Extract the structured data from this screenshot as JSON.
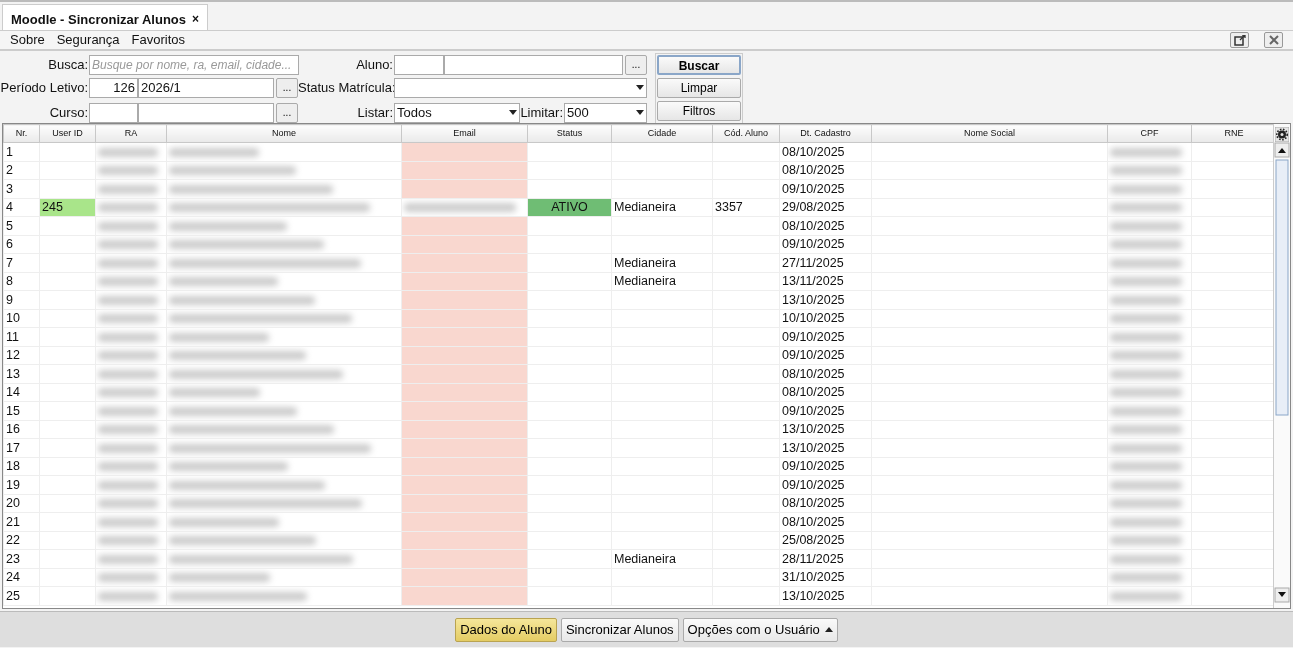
{
  "tab": {
    "title": "Moodle - Sincronizar Alunos",
    "close": "×"
  },
  "menu": [
    "Sobre",
    "Segurança",
    "Favoritos"
  ],
  "filters": {
    "busca": {
      "label": "Busca:",
      "placeholder": "Busque por nome, ra, email, cidade..."
    },
    "periodo": {
      "label": "Período Letivo:",
      "code": "126",
      "value": "2026/1",
      "lookup": "..."
    },
    "curso": {
      "label": "Curso:",
      "lookup": "..."
    },
    "aluno": {
      "label": "Aluno:",
      "lookup": "..."
    },
    "status_matricula": {
      "label": "Status Matrícula:"
    },
    "listar": {
      "label": "Listar:",
      "value": "Todos"
    },
    "limitar": {
      "label": "Limitar:",
      "value": "500"
    }
  },
  "actions": [
    {
      "label": "Buscar",
      "focused": true
    },
    {
      "label": "Limpar",
      "focused": false
    },
    {
      "label": "Filtros",
      "focused": false
    }
  ],
  "table": {
    "columns": [
      "Nr.",
      "User ID",
      "RA",
      "Nome",
      "Email",
      "Status",
      "Cidade",
      "Cód. Aluno",
      "Dt. Cadastro",
      "Nome Social",
      "CPF",
      "RNE"
    ],
    "rows": [
      {
        "nr": "1",
        "email_missing": true,
        "date": "08/10/2025"
      },
      {
        "nr": "2",
        "email_missing": true,
        "date": "08/10/2025"
      },
      {
        "nr": "3",
        "email_missing": true,
        "date": "09/10/2025"
      },
      {
        "nr": "4",
        "user_id": "245",
        "email_missing": false,
        "status": "ATIVO",
        "city": "Medianeira",
        "code": "3357",
        "date": "29/08/2025"
      },
      {
        "nr": "5",
        "email_missing": true,
        "date": "08/10/2025"
      },
      {
        "nr": "6",
        "email_missing": true,
        "date": "09/10/2025"
      },
      {
        "nr": "7",
        "email_missing": true,
        "city": "Medianeira",
        "date": "27/11/2025"
      },
      {
        "nr": "8",
        "email_missing": true,
        "city": "Medianeira",
        "date": "13/11/2025"
      },
      {
        "nr": "9",
        "email_missing": true,
        "date": "13/10/2025"
      },
      {
        "nr": "10",
        "email_missing": true,
        "date": "10/10/2025"
      },
      {
        "nr": "11",
        "email_missing": true,
        "date": "09/10/2025"
      },
      {
        "nr": "12",
        "email_missing": true,
        "date": "09/10/2025"
      },
      {
        "nr": "13",
        "email_missing": true,
        "date": "08/10/2025"
      },
      {
        "nr": "14",
        "email_missing": true,
        "date": "08/10/2025"
      },
      {
        "nr": "15",
        "email_missing": true,
        "date": "09/10/2025"
      },
      {
        "nr": "16",
        "email_missing": true,
        "date": "13/10/2025"
      },
      {
        "nr": "17",
        "email_missing": true,
        "date": "13/10/2025"
      },
      {
        "nr": "18",
        "email_missing": true,
        "date": "09/10/2025"
      },
      {
        "nr": "19",
        "email_missing": true,
        "date": "09/10/2025"
      },
      {
        "nr": "20",
        "email_missing": true,
        "date": "08/10/2025"
      },
      {
        "nr": "21",
        "email_missing": true,
        "date": "08/10/2025"
      },
      {
        "nr": "22",
        "email_missing": true,
        "date": "25/08/2025"
      },
      {
        "nr": "23",
        "email_missing": true,
        "city": "Medianeira",
        "date": "28/11/2025"
      },
      {
        "nr": "24",
        "email_missing": true,
        "date": "31/10/2025"
      },
      {
        "nr": "25",
        "email_missing": true,
        "date": "13/10/2025"
      }
    ]
  },
  "bottom_buttons": [
    {
      "label": "Dados do Aluno",
      "highlighted": true,
      "menu": false
    },
    {
      "label": "Sincronizar Alunos",
      "highlighted": false,
      "menu": false
    },
    {
      "label": "Opções com o Usuário",
      "highlighted": false,
      "menu": true
    }
  ]
}
